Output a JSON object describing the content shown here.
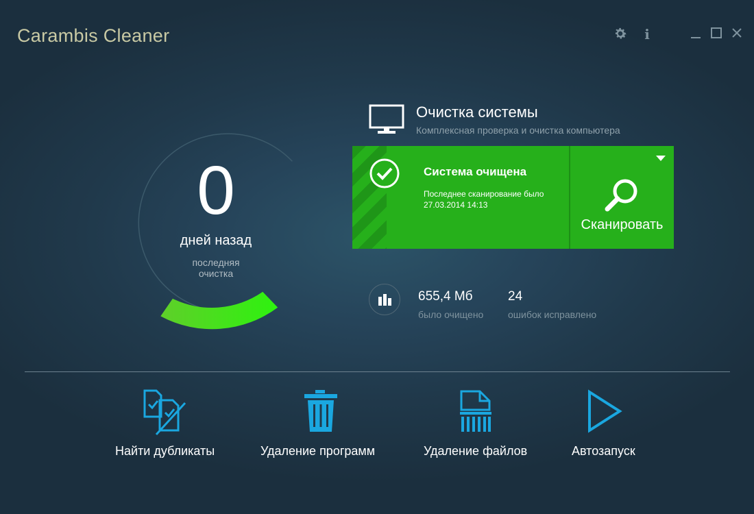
{
  "app": {
    "title": "Carambis Cleaner"
  },
  "window_controls": {
    "settings_icon": "gear-icon",
    "info_icon": "info-icon",
    "info_glyph": "i",
    "minimize_icon": "minimize-icon",
    "maximize_icon": "maximize-icon",
    "close_icon": "close-icon"
  },
  "last_clean": {
    "days": "0",
    "days_label": "дней назад",
    "sub_line1": "последняя",
    "sub_line2": "очистка",
    "progress_fraction": 0.25
  },
  "system": {
    "title": "Очистка системы",
    "subtitle": "Комплексная проверка и очистка компьютера"
  },
  "status": {
    "title": "Система очищена",
    "line1": "Последнее сканирование было",
    "line2": "27.03.2014 14:13"
  },
  "scan": {
    "label": "Сканировать"
  },
  "stats": {
    "cleaned_value": "655,4 Мб",
    "cleaned_label": "было очищено",
    "errors_value": "24",
    "errors_label": "ошибок исправлено"
  },
  "tools": [
    {
      "label": "Найти дубликаты",
      "icon": "duplicates-icon"
    },
    {
      "label": "Удаление программ",
      "icon": "trash-icon"
    },
    {
      "label": "Удаление файлов",
      "icon": "shred-file-icon"
    },
    {
      "label": "Автозапуск",
      "icon": "play-icon"
    }
  ],
  "colors": {
    "accent_green": "#26b01b",
    "tool_blue": "#1aa7e0",
    "title_color": "#c8c9a4"
  }
}
